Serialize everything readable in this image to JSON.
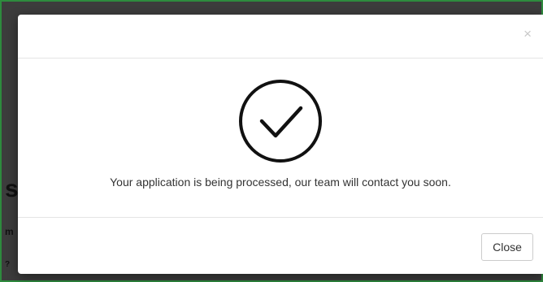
{
  "background": {
    "fragment_heading": "si",
    "fragment_line1": "m",
    "fragment_line2": "?"
  },
  "modal": {
    "close_glyph": "×",
    "success_icon": "check-circle-icon",
    "message": "Your application is being processed, our team will contact you soon.",
    "close_button_label": "Close"
  },
  "colors": {
    "page_border": "#2e8b3e",
    "overlay": "#3c3c3c",
    "modal_background": "#ffffff",
    "text": "#333333",
    "divider": "#e5e5e5"
  }
}
